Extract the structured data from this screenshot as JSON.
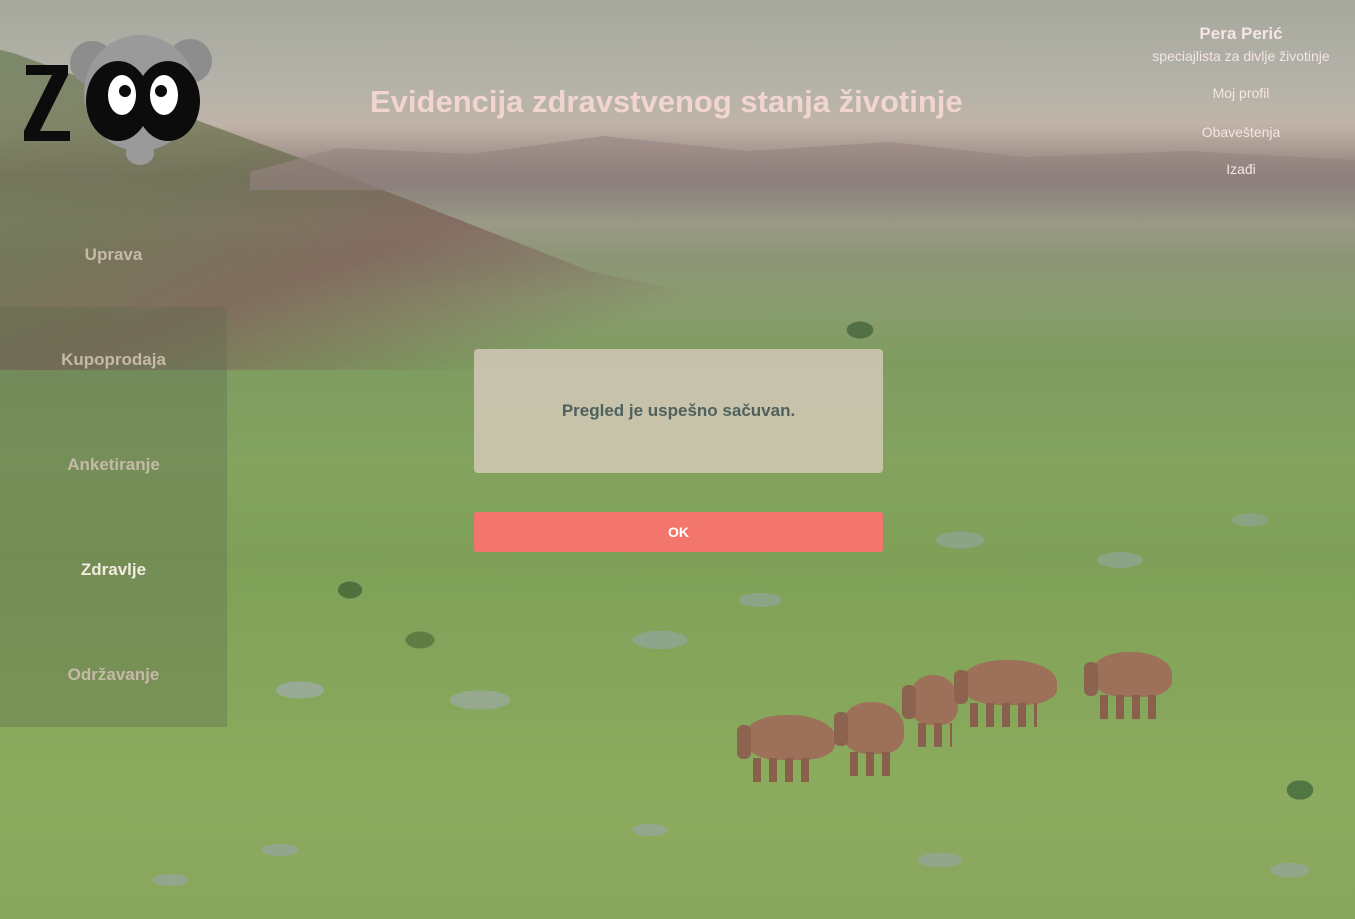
{
  "header": {
    "title": "Evidencija zdravstvenog stanja životinje",
    "logo_text": "ZOO"
  },
  "user": {
    "name": "Pera Perić",
    "role": "speciajlista za divlje životinje",
    "links": {
      "profile": "Moj profil",
      "notifications": "Obaveštenja",
      "logout": "Izađi"
    }
  },
  "sidebar": {
    "items": [
      {
        "label": "Uprava",
        "active": false
      },
      {
        "label": "Kupoprodaja",
        "active": false
      },
      {
        "label": "Anketiranje",
        "active": false
      },
      {
        "label": "Zdravlje",
        "active": true
      },
      {
        "label": "Održavanje",
        "active": false
      }
    ]
  },
  "dialog": {
    "message": "Pregled je uspešno sačuvan.",
    "ok_label": "OK"
  },
  "colors": {
    "accent_button": "#f3766d",
    "title_text": "#f1d5d0",
    "dialog_text": "#4f615d"
  }
}
